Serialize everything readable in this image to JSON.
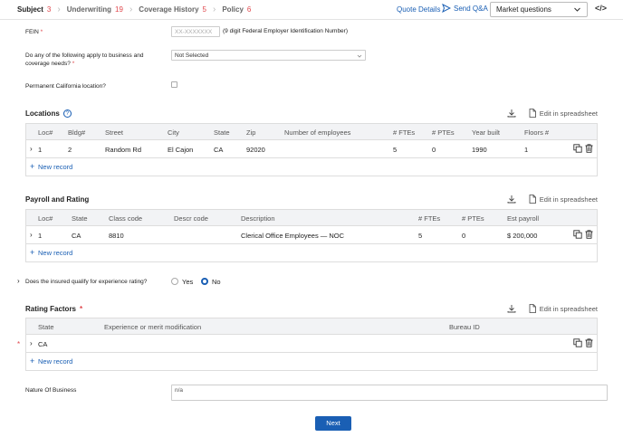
{
  "nav": {
    "steps": [
      {
        "label": "Subject",
        "count": "3",
        "active": true
      },
      {
        "label": "Underwriting",
        "count": "19",
        "active": false
      },
      {
        "label": "Coverage History",
        "count": "5",
        "active": false
      },
      {
        "label": "Policy",
        "count": "6",
        "active": false
      }
    ],
    "quote_details": "Quote Details",
    "send_qa": "Send Q&A",
    "market_select": "Market questions",
    "code_icon": "</>"
  },
  "form": {
    "fein_label": "FEIN",
    "fein_placeholder": "XX-XXXXXXX",
    "fein_hint": "(9 digit Federal Employer Identification Number)",
    "coverage_label_1": "Do any of the following apply to business and",
    "coverage_label_2": "coverage needs?",
    "coverage_value": "Not Selected",
    "ca_location_label": "Permanent California location?",
    "experience_label": "Does the insured qualify for experience rating?",
    "yes_label": "Yes",
    "no_label": "No",
    "nature_label": "Nature Of Business",
    "nature_value": "n/a",
    "required_mark": "*"
  },
  "locations": {
    "title": "Locations",
    "help": "?",
    "edit_sheet": "Edit in spreadsheet",
    "columns": [
      "Loc#",
      "Bldg#",
      "Street",
      "City",
      "State",
      "Zip",
      "Number of employees",
      "# FTEs",
      "# PTEs",
      "Year built",
      "Floors #"
    ],
    "rows": [
      [
        "1",
        "2",
        "Random Rd",
        "El Cajon",
        "CA",
        "92020",
        "",
        "5",
        "0",
        "1990",
        "1"
      ]
    ],
    "new_record": "New record"
  },
  "payroll": {
    "title": "Payroll and Rating",
    "edit_sheet": "Edit in spreadsheet",
    "columns": [
      "Loc#",
      "State",
      "Class code",
      "Descr code",
      "Description",
      "# FTEs",
      "# PTEs",
      "Est payroll"
    ],
    "rows": [
      [
        "1",
        "CA",
        "8810",
        "",
        "Clerical Office Employees — NOC",
        "5",
        "0",
        "$ 200,000"
      ]
    ],
    "new_record": "New record"
  },
  "rating": {
    "title": "Rating Factors",
    "edit_sheet": "Edit in spreadsheet",
    "columns": [
      "State",
      "Experience or merit modification",
      "Bureau ID"
    ],
    "rows": [
      [
        "CA",
        "",
        ""
      ]
    ],
    "new_record": "New record"
  },
  "next_label": "Next",
  "colors": {
    "accent": "#1a5fb4",
    "required": "#e0474c"
  }
}
